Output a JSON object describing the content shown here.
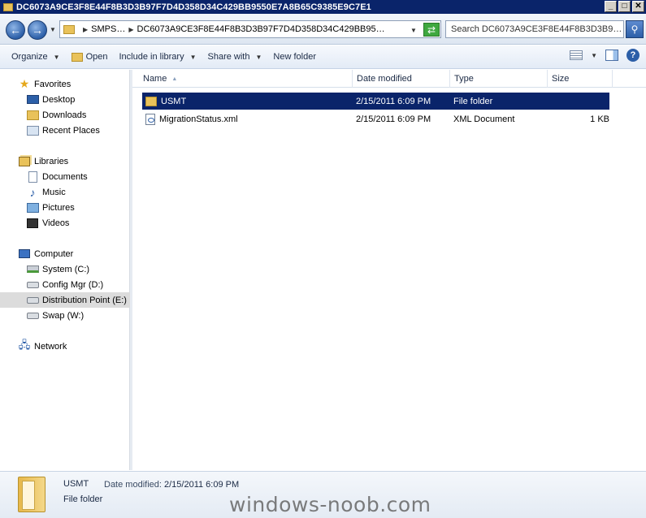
{
  "window": {
    "title": "DC6073A9CE3F8E44F8B3D3B97F7D4D358D34C429BB9550E7A8B65C9385E9C7E1",
    "minimize": "_",
    "maximize": "□",
    "close": "✕"
  },
  "address": {
    "back": "←",
    "forward": "→",
    "crumbs": [
      "SMPS…",
      "DC6073A9CE3F8E44F8B3D3B97F7D4D358D34C429BB95…"
    ],
    "search_placeholder": "Search DC6073A9CE3F8E44F8B3D3B9…"
  },
  "toolbar": {
    "organize": "Organize",
    "open": "Open",
    "include_in_library": "Include in library",
    "share_with": "Share with",
    "new_folder": "New folder",
    "help": "?"
  },
  "nav": {
    "favorites": "Favorites",
    "desktop": "Desktop",
    "downloads": "Downloads",
    "recent_places": "Recent Places",
    "libraries": "Libraries",
    "documents": "Documents",
    "music": "Music",
    "pictures": "Pictures",
    "videos": "Videos",
    "computer": "Computer",
    "system_c": "System (C:)",
    "configmgr_d": "Config Mgr (D:)",
    "distribution_e": "Distribution Point (E:)",
    "swap_w": "Swap (W:)",
    "network": "Network"
  },
  "columns": {
    "name": "Name",
    "date_modified": "Date modified",
    "type": "Type",
    "size": "Size"
  },
  "files": [
    {
      "name": "USMT",
      "date": "2/15/2011 6:09 PM",
      "type": "File folder",
      "size": ""
    },
    {
      "name": "MigrationStatus.xml",
      "date": "2/15/2011 6:09 PM",
      "type": "XML Document",
      "size": "1 KB"
    }
  ],
  "details": {
    "name": "USMT",
    "type": "File folder",
    "date_label": "Date modified:",
    "date_value": "2/15/2011 6:09 PM"
  },
  "watermark": "windows-noob.com",
  "colors": {
    "titlebar": "#0a246a",
    "selection": "#0a246a",
    "folder": "#e9c25a"
  }
}
